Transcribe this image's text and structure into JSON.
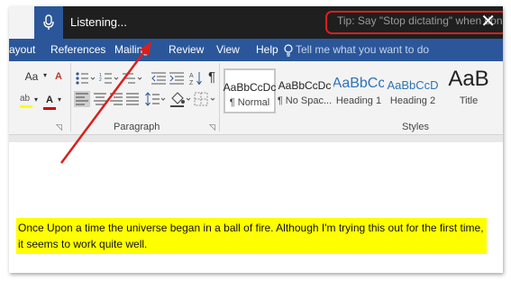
{
  "dictation": {
    "status_text": "Listening...",
    "tip_text": "Tip: Say \"Stop dictating\" when done",
    "close_glyph": "✕",
    "mic_icon": "microphone-icon",
    "highlight_color": "#d9201b"
  },
  "tabs": [
    {
      "label": "ayout"
    },
    {
      "label": "References"
    },
    {
      "label": "Mailing"
    },
    {
      "label": "Review"
    },
    {
      "label": "View"
    },
    {
      "label": "Help"
    }
  ],
  "tell_me": {
    "placeholder": "Tell me what you want to do",
    "icon": "lightbulb-icon"
  },
  "ribbon": {
    "font_group": {
      "change_case": "Aa",
      "clear_format": "A"
    },
    "paragraph_group": {
      "label": "Paragraph",
      "pilcrow": "¶"
    },
    "styles_group": {
      "label": "Styles"
    },
    "styles": [
      {
        "preview": "AaBbCcDc",
        "name": "¶ Normal"
      },
      {
        "preview": "AaBbCcDc",
        "name": "¶ No Spac..."
      },
      {
        "preview": "AaBbCc",
        "name": "Heading 1"
      },
      {
        "preview": "AaBbCcD",
        "name": "Heading 2"
      },
      {
        "preview": "AaB",
        "name": "Title"
      }
    ]
  },
  "document": {
    "text": "Once Upon a time the universe began in a ball of fire. Although I'm trying this out for the first time, it seems to work quite well.",
    "highlight_color": "#ffff00"
  },
  "colors": {
    "brand": "#2b579a",
    "dictation_bar": "#1f1f1f",
    "annotation_arrow": "#d9201b"
  }
}
